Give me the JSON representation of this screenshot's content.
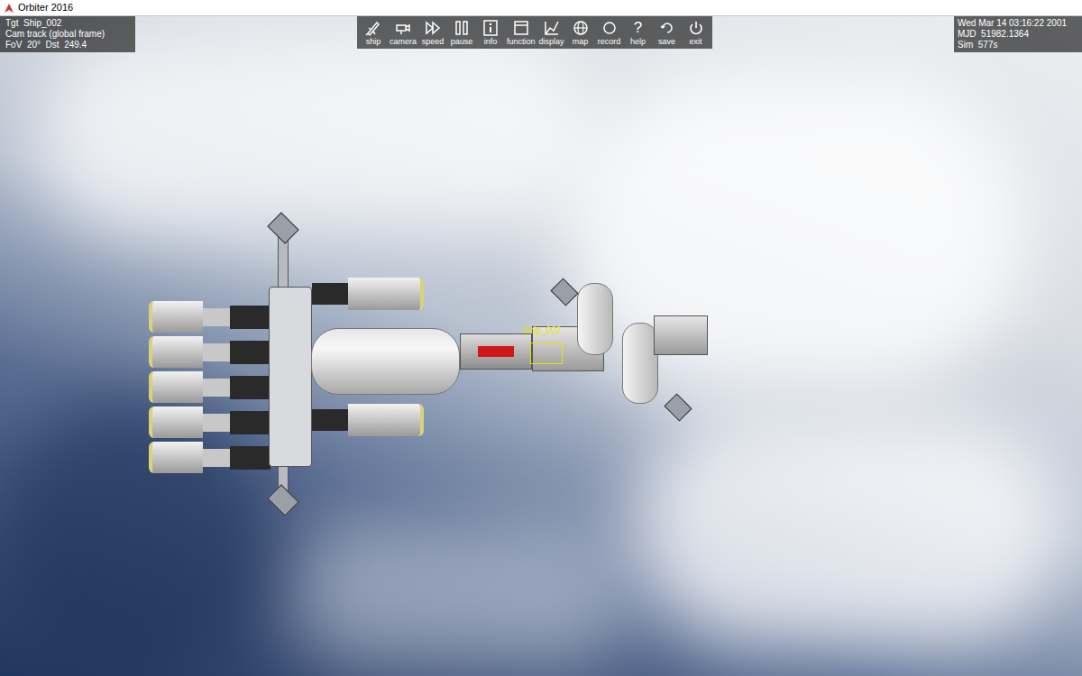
{
  "window": {
    "title": "Orbiter 2016"
  },
  "hud": {
    "lines": [
      "Tgt  Ship_002",
      "Cam track (global frame)",
      "FoV  20°  Dst  249.4"
    ]
  },
  "toolbar": [
    {
      "label": "ship"
    },
    {
      "label": "camera"
    },
    {
      "label": "speed"
    },
    {
      "label": "pause"
    },
    {
      "label": "info"
    },
    {
      "label": "function"
    },
    {
      "label": "display"
    },
    {
      "label": "map"
    },
    {
      "label": "record"
    },
    {
      "label": "help",
      "glyph": "?"
    },
    {
      "label": "save"
    },
    {
      "label": "exit"
    }
  ],
  "clock": [
    "Wed Mar 14 03:16:22 2001",
    "MJD  51982.1364",
    "Sim  577s"
  ],
  "scene": {
    "target_label": "Ship_002"
  }
}
